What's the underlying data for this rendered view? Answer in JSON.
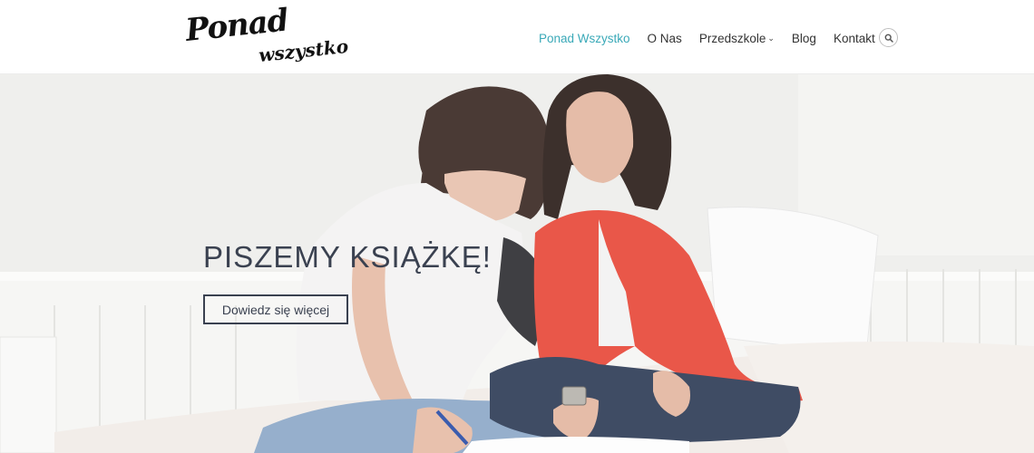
{
  "logo": {
    "line1": "Ponad",
    "line2": "wszystko"
  },
  "nav": {
    "items": [
      {
        "label": "Ponad Wszystko",
        "active": true
      },
      {
        "label": "O Nas"
      },
      {
        "label": "Przedszkole",
        "has_dropdown": true
      },
      {
        "label": "Blog"
      },
      {
        "label": "Kontakt"
      }
    ],
    "search_icon": "search-icon",
    "active_color": "#3aa9b8"
  },
  "hero": {
    "title": "PISZEMY KSIĄŻKĘ!",
    "button_label": "Dowiedz się więcej",
    "text_color": "#3a4150"
  }
}
